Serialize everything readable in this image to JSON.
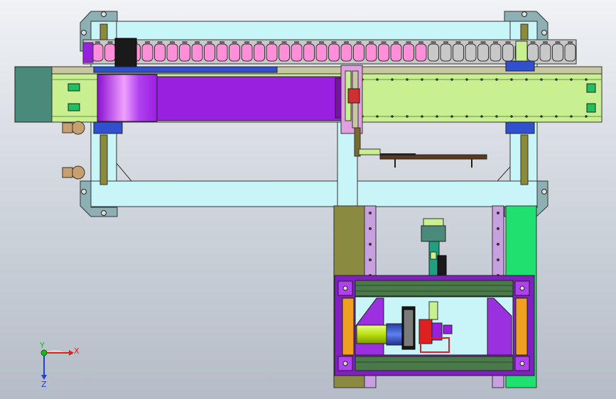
{
  "viewport": {
    "background_top": "#f0f2f5",
    "background_bottom": "#b4bcc7"
  },
  "colors": {
    "frame_cyan": "#c8f5f8",
    "plate_grey": "#8cb0b4",
    "rail_olive": "#8a8a3a",
    "rail_light": "#c8c8a0",
    "chain_pink": "#ff8fd8",
    "chain_frame": "#a0a0a0",
    "slider_black": "#1a1a1a",
    "beam_lime": "#c8f090",
    "motor_teal": "#4a8a7a",
    "carriage_purple": "#9a20e0",
    "carriage_light": "#f0a0ff",
    "block_blue": "#3050d0",
    "bracket_pink": "#e0a0e0",
    "post_olive": "#8a8a40",
    "post_green": "#20e070",
    "rail_lavender": "#c8a0e0",
    "box_purple": "#8020c0",
    "extrusion_orange": "#f0a020",
    "beam_darkgreen": "#4a7a4a",
    "cylinder_yellowgreen": "#c8f020",
    "motor_blue": "#4060d0",
    "gripper_red": "#e02020",
    "gauge_tan": "#c8a070"
  },
  "triad": {
    "x_label": "X",
    "y_label": "Y",
    "z_label": "Z"
  }
}
